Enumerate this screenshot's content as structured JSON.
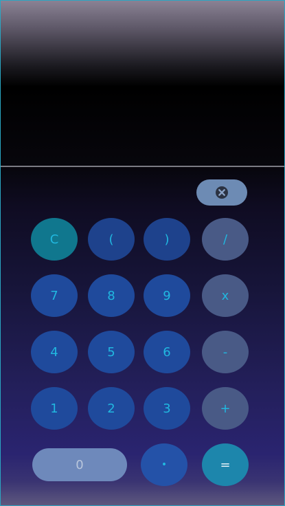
{
  "display": {
    "expression": "",
    "result": ""
  },
  "keys": {
    "backspace_icon": "backspace-x-icon",
    "clear": "C",
    "open_paren": "(",
    "close_paren": ")",
    "divide": "/",
    "seven": "7",
    "eight": "8",
    "nine": "9",
    "multiply": "x",
    "four": "4",
    "five": "5",
    "six": "6",
    "subtract": "-",
    "one": "1",
    "two": "2",
    "three": "3",
    "add": "+",
    "zero": "0",
    "decimal": "•",
    "equals": "="
  },
  "colors": {
    "key_text": "#21b8e0",
    "digit_key": "#1f4a9c",
    "operator_key": "#495a86",
    "clear_key": "#10778e",
    "equals_key": "#1d86ac",
    "zero_key": "#6e89bb",
    "backspace_key": "#6d8bb4"
  }
}
